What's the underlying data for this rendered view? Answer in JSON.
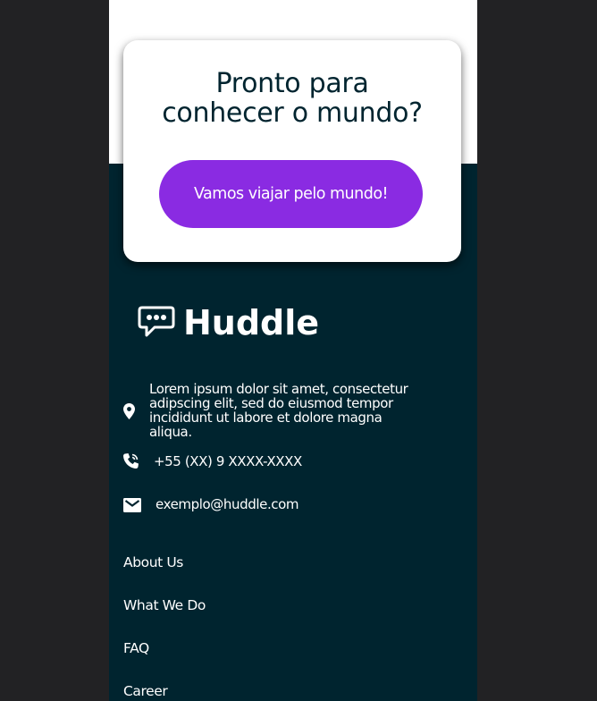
{
  "cta": {
    "title_line1": "Pronto para",
    "title_line2": "conhecer o mundo?",
    "button_label": "Vamos viajar pelo mundo!"
  },
  "footer": {
    "brand": "Huddle",
    "address": "Lorem ipsum dolor sit amet, consectetur adipscing elit, sed do eiusmod tempor incididunt ut labore et dolore magna aliqua.",
    "phone": "+55 (XX) 9 XXXX-XXXX",
    "email": "exemplo@huddle.com",
    "links": [
      {
        "label": "About Us"
      },
      {
        "label": "What We Do"
      },
      {
        "label": "FAQ"
      },
      {
        "label": "Career"
      }
    ]
  },
  "colors": {
    "page_background": "#222224",
    "footer_background": "#00242f",
    "accent_purple": "#8a2be2",
    "card_background": "#ffffff"
  },
  "icons": [
    "chat-bubble-logo-icon",
    "location-pin-icon",
    "phone-icon",
    "mail-icon"
  ]
}
